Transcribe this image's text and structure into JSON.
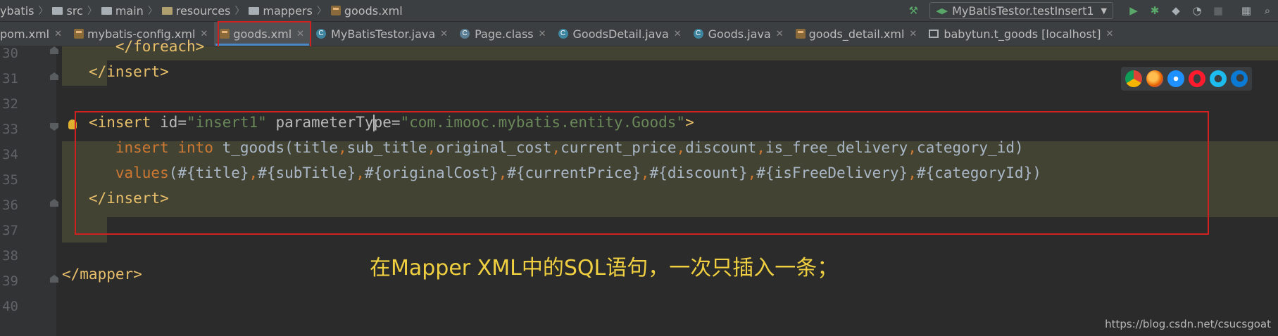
{
  "breadcrumbs": [
    "ybatis",
    "src",
    "main",
    "resources",
    "mappers",
    "goods.xml"
  ],
  "run_config": "MyBatisTestor.testInsert1",
  "tabs": [
    {
      "label": "pom.xml",
      "icon": "maven-icon"
    },
    {
      "label": "mybatis-config.xml",
      "icon": "xml-file-icon"
    },
    {
      "label": "goods.xml",
      "icon": "xml-file-icon",
      "active": true
    },
    {
      "label": "MyBatisTestor.java",
      "icon": "java-class-icon"
    },
    {
      "label": "Page.class",
      "icon": "compiled-class-icon"
    },
    {
      "label": "GoodsDetail.java",
      "icon": "java-class-icon"
    },
    {
      "label": "Goods.java",
      "icon": "java-class-icon"
    },
    {
      "label": "goods_detail.xml",
      "icon": "xml-file-icon"
    },
    {
      "label": "babytun.t_goods [localhost]",
      "icon": "database-table-icon"
    }
  ],
  "line_numbers": [
    "30",
    "31",
    "32",
    "33",
    "34",
    "35",
    "36",
    "37",
    "38",
    "39",
    "40"
  ],
  "code": {
    "l30_tag": "</foreach>",
    "l31_tag": "</insert>",
    "l33_tag_open": "<insert ",
    "l33_attr1": "id=",
    "l33_val1": "\"insert1\"",
    "l33_attr2a": "parameterTy",
    "l33_attr2b": "pe=",
    "l33_val2": "\"com.imooc.mybatis.entity.Goods\"",
    "l33_tag_close": ">",
    "l34_kw1": "insert",
    "l34_kw2": "into",
    "l34_table": "t_goods(title",
    "l34_c1": "sub_title",
    "l34_c2": "original_cost",
    "l34_c3": "current_price",
    "l34_c4": "discount",
    "l34_c5": "is_free_delivery",
    "l34_c6": "category_id)",
    "l35_kw": "values",
    "l35_v0": "(#{title}",
    "l35_v1": "#{subTitle}",
    "l35_v2": "#{originalCost}",
    "l35_v3": "#{currentPrice}",
    "l35_v4": "#{discount}",
    "l35_v5": "#{isFreeDelivery}",
    "l35_v6": "#{categoryId})",
    "comma": ",",
    "l36_tag": "</insert>",
    "l39_tag": "</mapper>"
  },
  "annotation": "在Mapper XML中的SQL语句，一次只插入一条；",
  "watermark": "https://blog.csdn.net/csucsgoat",
  "browser_icons": [
    "chrome-icon",
    "firefox-icon",
    "safari-icon",
    "opera-icon",
    "ie-icon",
    "edge-icon"
  ],
  "colors": {
    "tag": "#e8bf6a",
    "string": "#6a8759",
    "keyword": "#cc7832",
    "annotation": "#f0d040",
    "highlight_box": "#d02020"
  }
}
